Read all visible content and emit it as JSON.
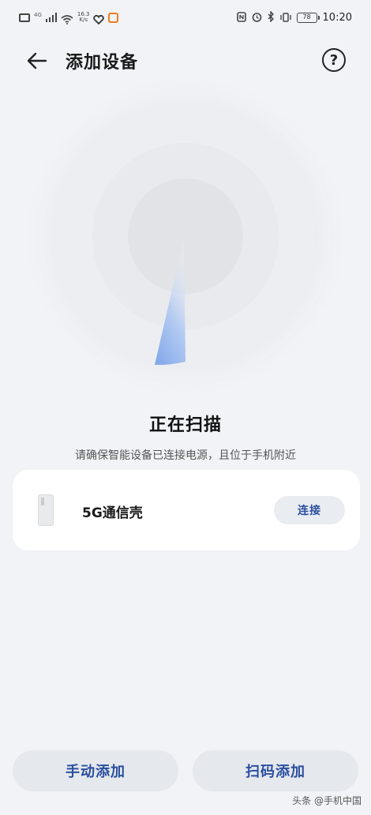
{
  "status_bar": {
    "net_tag_1": "4G",
    "net_tag_2": "4G",
    "speed_value": "16.3",
    "speed_unit": "K/s",
    "battery": "78",
    "time": "10:20"
  },
  "header": {
    "title": "添加设备",
    "help_glyph": "?"
  },
  "scan": {
    "title": "正在扫描",
    "hint": "请确保智能设备已连接电源，且位于手机附近"
  },
  "device": {
    "name": "5G通信壳",
    "connect_label": "连接"
  },
  "actions": {
    "manual_add": "手动添加",
    "scan_add": "扫码添加"
  },
  "watermark": "头条 @手机中国",
  "colors": {
    "accent": "#2a4fa0",
    "beam": "#7ea6ea",
    "background": "#f1f3f6"
  }
}
